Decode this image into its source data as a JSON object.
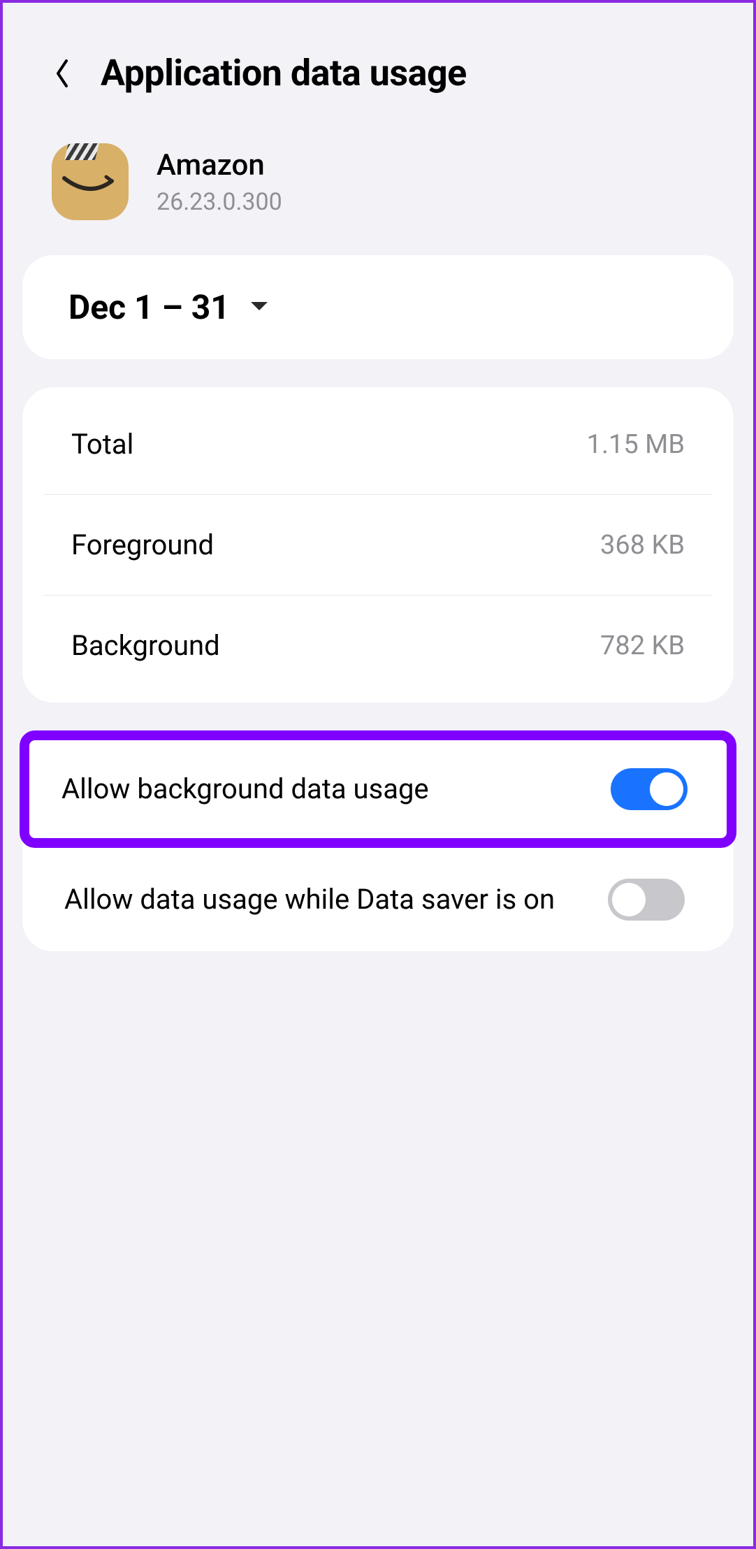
{
  "header": {
    "title": "Application data usage"
  },
  "app": {
    "name": "Amazon",
    "version": "26.23.0.300"
  },
  "date_range": {
    "label": "Dec 1 – 31"
  },
  "usage": {
    "rows": [
      {
        "label": "Total",
        "value": "1.15 MB"
      },
      {
        "label": "Foreground",
        "value": "368 KB"
      },
      {
        "label": "Background",
        "value": "782 KB"
      }
    ]
  },
  "settings": {
    "allow_bg": {
      "label": "Allow background data usage",
      "on": true
    },
    "allow_saver": {
      "label": "Allow data usage while Data saver is on",
      "on": false
    }
  }
}
